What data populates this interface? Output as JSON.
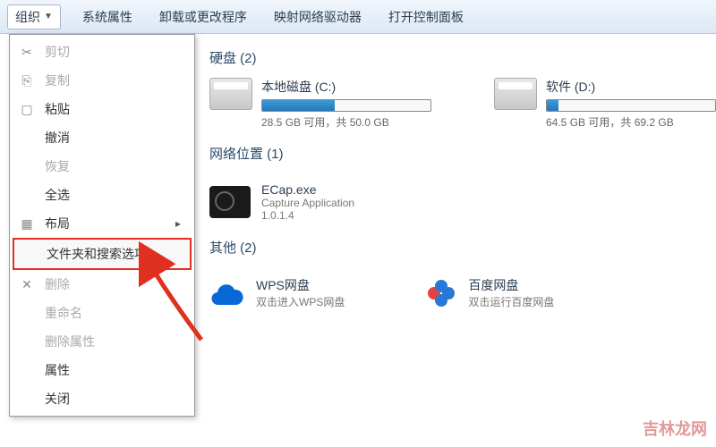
{
  "toolbar": {
    "organize": "组织",
    "items": [
      "系统属性",
      "卸载或更改程序",
      "映射网络驱动器",
      "打开控制面板"
    ]
  },
  "menu": {
    "cut": "剪切",
    "copy": "复制",
    "paste": "粘贴",
    "undo": "撤消",
    "redo": "恢复",
    "selectAll": "全选",
    "layout": "布局",
    "folderOptions": "文件夹和搜索选项",
    "delete": "删除",
    "rename": "重命名",
    "removeProps": "删除属性",
    "properties": "属性",
    "close": "关闭"
  },
  "sections": {
    "drives": "硬盘 (2)",
    "network": "网络位置 (1)",
    "other": "其他 (2)"
  },
  "drives": {
    "c": {
      "name": "本地磁盘 (C:)",
      "text": "28.5 GB 可用，共 50.0 GB",
      "fill": 43
    },
    "d": {
      "name": "软件 (D:)",
      "text": "64.5 GB 可用，共 69.2 GB",
      "fill": 7
    }
  },
  "ecap": {
    "name": "ECap.exe",
    "desc": "Capture Application",
    "ver": "1.0.1.4"
  },
  "wps": {
    "name": "WPS网盘",
    "sub": "双击进入WPS网盘"
  },
  "baidu": {
    "name": "百度网盘",
    "sub": "双击运行百度网盘"
  },
  "watermark": "吉林龙网"
}
